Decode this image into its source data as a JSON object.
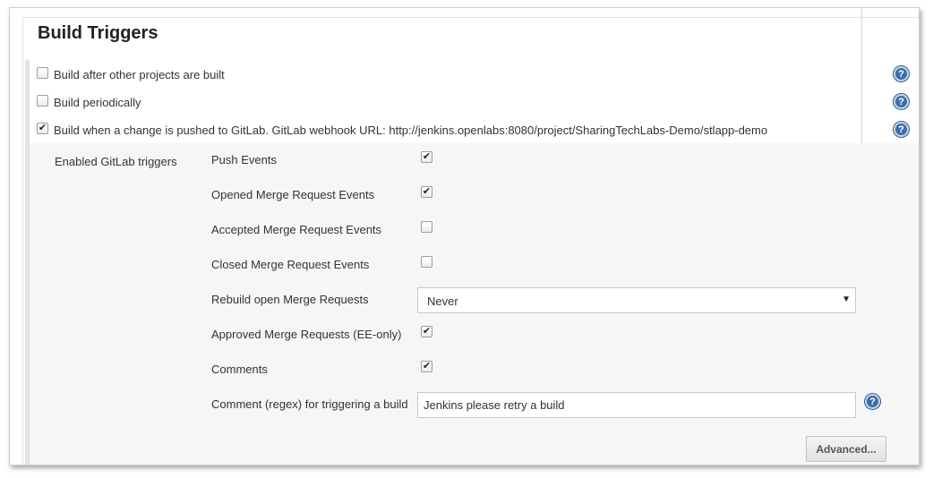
{
  "section": {
    "title": "Build Triggers"
  },
  "triggers": [
    {
      "label": "Build after other projects are built",
      "checked": false
    },
    {
      "label": "Build periodically",
      "checked": false
    },
    {
      "label": "Build when a change is pushed to GitLab. GitLab webhook URL: http://jenkins.openlabs:8080/project/SharingTechLabs-Demo/stlapp-demo",
      "checked": true
    }
  ],
  "gitlab": {
    "section_label": "Enabled GitLab triggers",
    "options": [
      {
        "label": "Push Events",
        "checked": true
      },
      {
        "label": "Opened Merge Request Events",
        "checked": true
      },
      {
        "label": "Accepted Merge Request Events",
        "checked": false
      },
      {
        "label": "Closed Merge Request Events",
        "checked": false
      },
      {
        "label": "Rebuild open Merge Requests",
        "value": "Never"
      },
      {
        "label": "Approved Merge Requests (EE-only)",
        "checked": true
      },
      {
        "label": "Comments",
        "checked": true
      },
      {
        "label": "Comment (regex) for triggering a build",
        "value": "Jenkins please retry a build"
      }
    ],
    "advanced_label": "Advanced..."
  },
  "glyphs": {
    "check": "✔",
    "caret": "▼",
    "help": "?"
  },
  "colors": {
    "help_icon": "#3b6ea8",
    "nested_background": "#f6f6f6",
    "block_bar": "#e3e3e3"
  }
}
